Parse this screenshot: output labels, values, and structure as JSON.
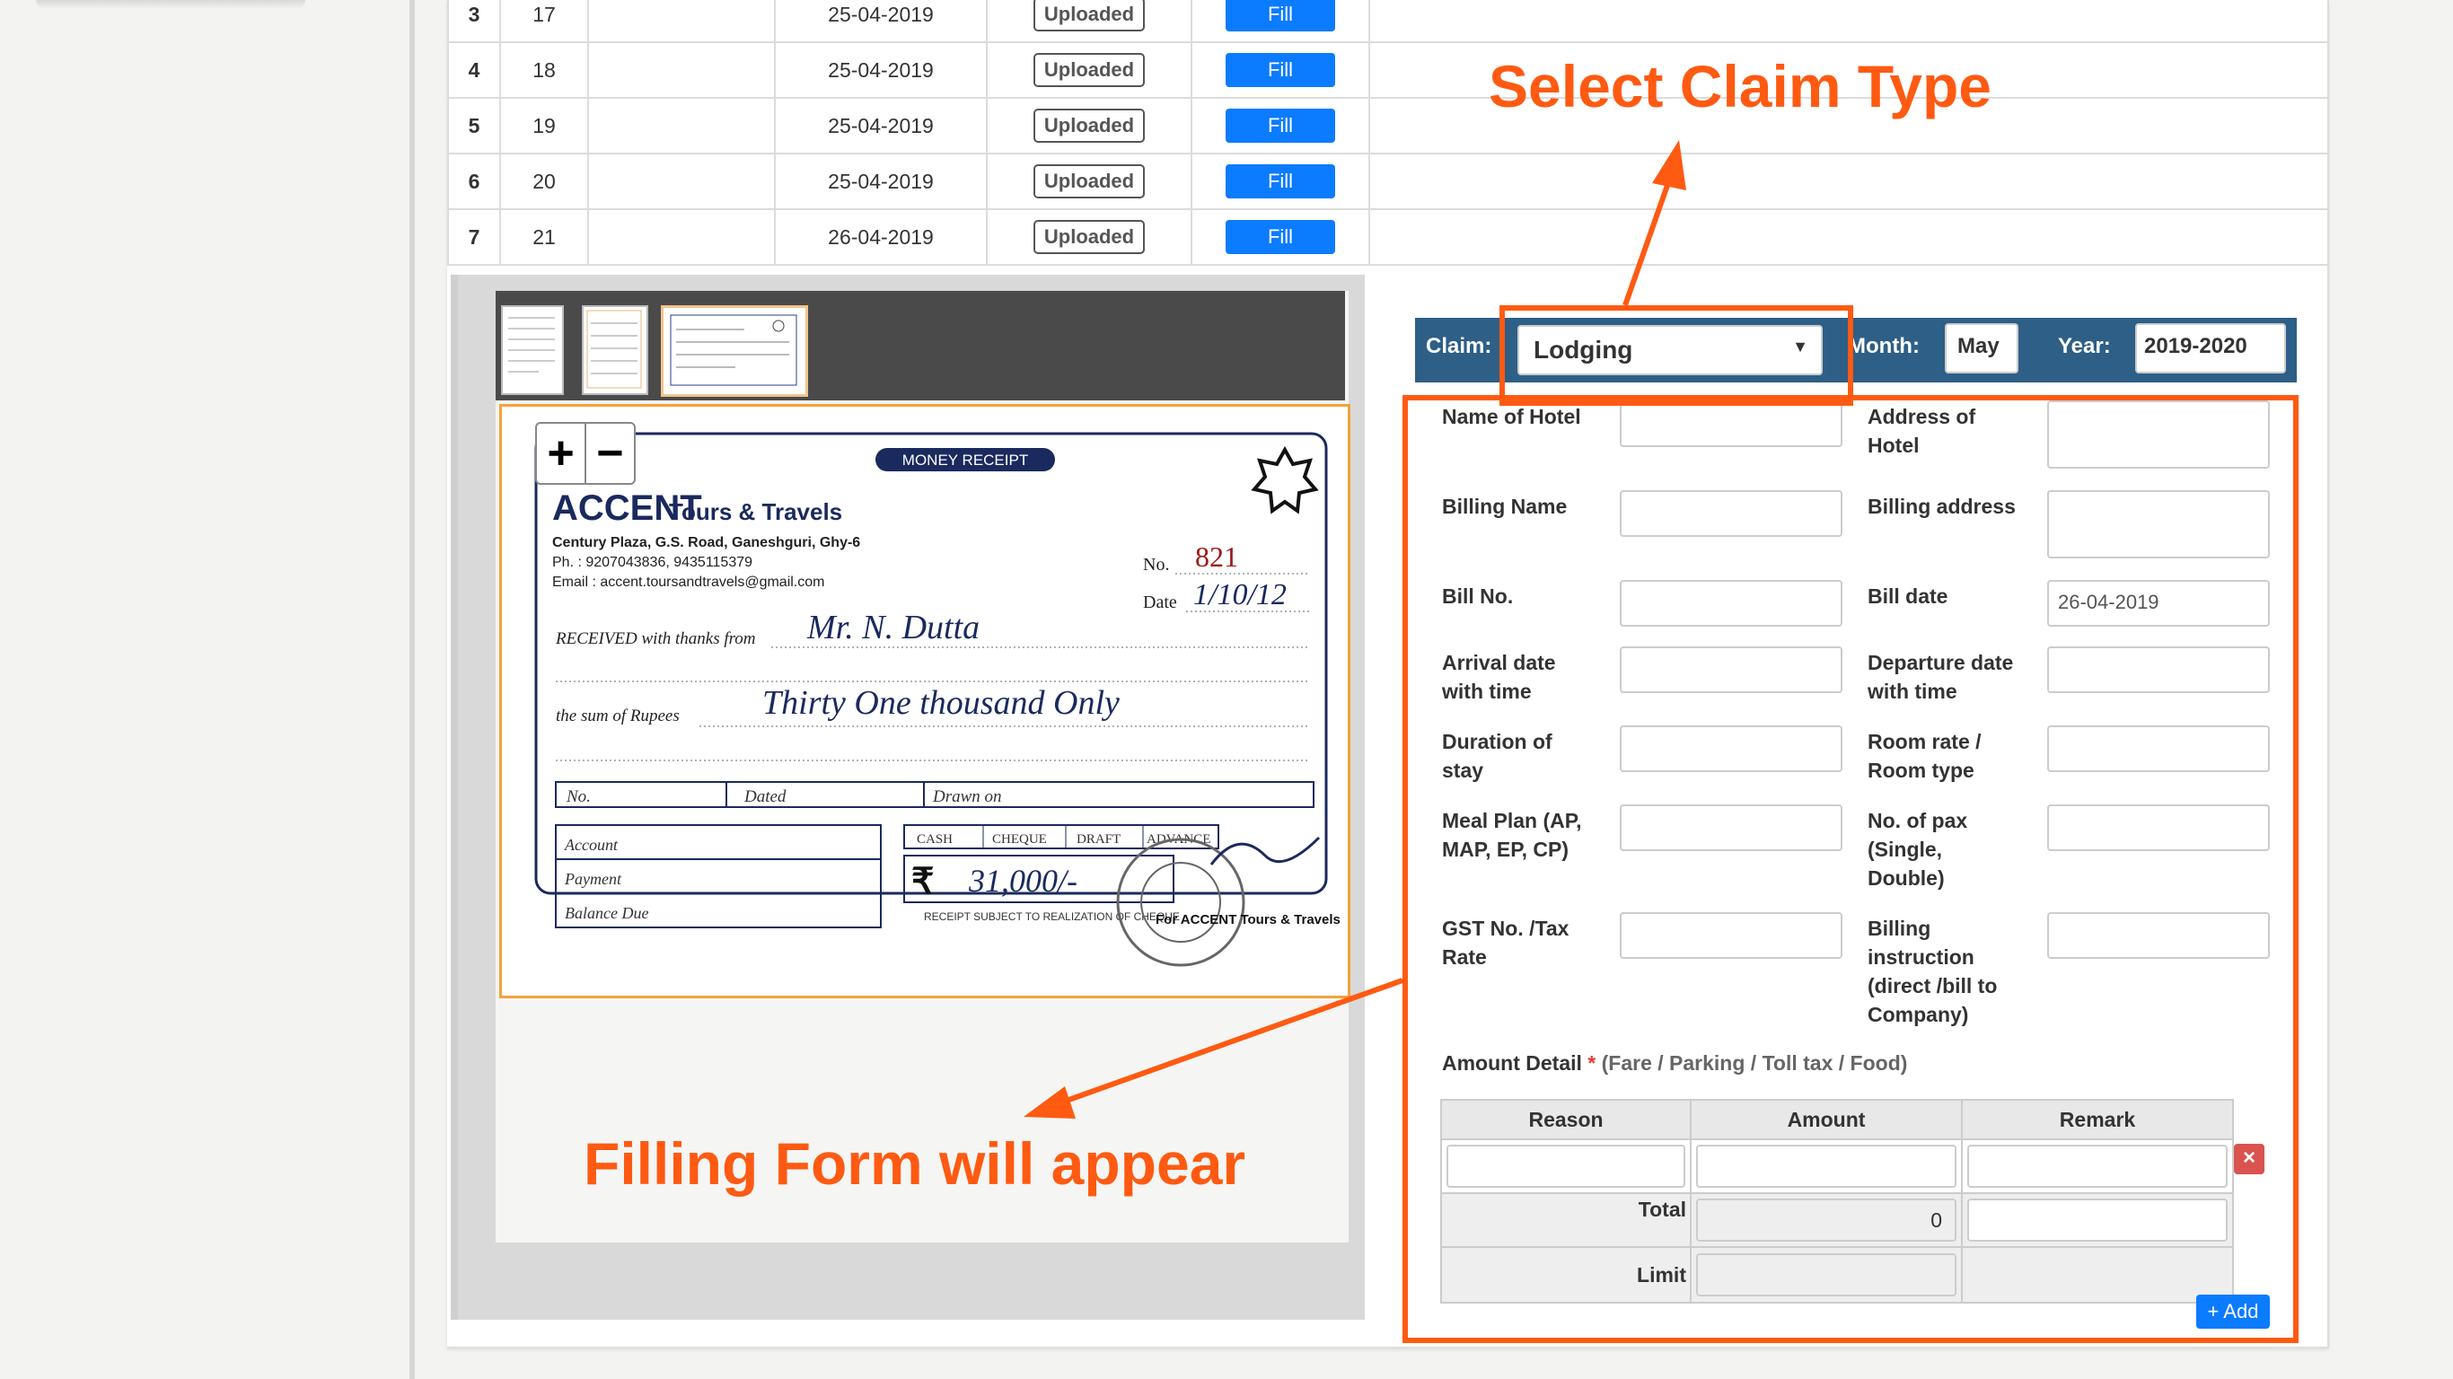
{
  "table": {
    "rows": [
      {
        "no": "3",
        "id": "17",
        "date": "25-04-2019",
        "status": "Uploaded",
        "action": "Fill"
      },
      {
        "no": "4",
        "id": "18",
        "date": "25-04-2019",
        "status": "Uploaded",
        "action": "Fill"
      },
      {
        "no": "5",
        "id": "19",
        "date": "25-04-2019",
        "status": "Uploaded",
        "action": "Fill"
      },
      {
        "no": "6",
        "id": "20",
        "date": "25-04-2019",
        "status": "Uploaded",
        "action": "Fill"
      },
      {
        "no": "7",
        "id": "21",
        "date": "26-04-2019",
        "status": "Uploaded",
        "action": "Fill"
      }
    ]
  },
  "viewer": {
    "zoom_in": "+",
    "zoom_out": "−",
    "receipt": {
      "badge": "MONEY RECEIPT",
      "company": "ACCENT",
      "company_suffix": "Tours & Travels",
      "address": "Century Plaza, G.S. Road, Ganeshguri, Ghy-6",
      "phone": "Ph. : 9207043836, 9435115379",
      "email": "Email : accent.toursandtravels@gmail.com",
      "no_label": "No.",
      "no_value": "821",
      "date_label": "Date",
      "date_value": "1/10/12",
      "received_label": "RECEIVED with thanks from",
      "received_value": "Mr. N. Dutta",
      "sum_label": "the sum of Rupees",
      "sum_value": "Thirty One thousand Only",
      "col_no": "No.",
      "col_dated": "Dated",
      "col_drawn": "Drawn on",
      "account": "Account",
      "payment": "Payment",
      "balance": "Balance Due",
      "modes": [
        "CASH",
        "CHEQUE",
        "DRAFT",
        "ADVANCE"
      ],
      "amount": "31,000/-",
      "footer": "RECEIPT SUBJECT TO REALIZATION OF CHEQUE",
      "signoff": "For ACCENT Tours & Travels"
    }
  },
  "form": {
    "claim_label": "Claim:",
    "claim_value": "Lodging",
    "month_label": "Month:",
    "month_value": "May",
    "year_label": "Year:",
    "year_value": "2019-2020",
    "fields_left": [
      "Name of Hotel",
      "Billing Name",
      "Bill No.",
      "Arrival date with time",
      "Duration of stay",
      "Meal Plan (AP, MAP, EP, CP)",
      "GST No. /Tax Rate"
    ],
    "fields_right": [
      "Address of Hotel",
      "Billing address",
      "Bill date",
      "Departure date with time",
      "Room rate / Room type",
      "No. of pax (Single, Double)",
      "Billing instruction (direct /bill to Company)"
    ],
    "bill_date_value": "26-04-2019",
    "amount_detail_label": "Amount Detail",
    "required_mark": "*",
    "amount_detail_hint": "(Fare / Parking / Toll tax / Food)",
    "col_reason": "Reason",
    "col_amount": "Amount",
    "col_remark": "Remark",
    "total_label": "Total",
    "total_value": "0",
    "limit_label": "Limit",
    "delete_icon": "×",
    "add_label": "+ Add"
  },
  "annotations": {
    "select_claim": "Select Claim Type",
    "filling_form": "Filling Form will appear",
    "color": "#ff5a12"
  }
}
